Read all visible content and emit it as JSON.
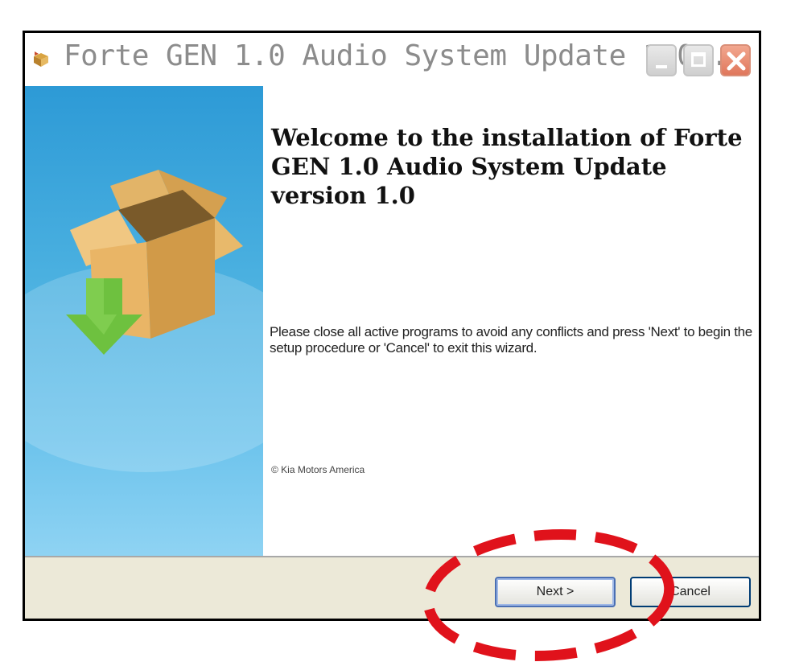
{
  "window": {
    "title": "Forte GEN 1.0 Audio System Update 1.0...",
    "controls": [
      "minimize",
      "maximize",
      "close"
    ]
  },
  "content": {
    "heading": "Welcome to the installation of Forte GEN 1.0 Audio System Update version 1.0",
    "instructions": "Please close all active programs to avoid any conflicts and press 'Next' to begin the setup procedure or 'Cancel' to exit this wizard.",
    "copyright": "© Kia Motors America"
  },
  "footer": {
    "next_label": "Next >",
    "cancel_label": "Cancel"
  },
  "colors": {
    "sidebar": "#3aa6dc",
    "annotation": "#e0121b",
    "close_button": "#e0775c"
  },
  "icons": [
    "app-box-icon",
    "installer-box-icon",
    "download-arrow-icon"
  ]
}
